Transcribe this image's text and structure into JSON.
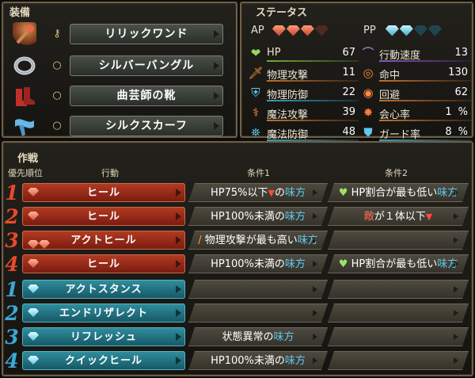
{
  "equipment": {
    "title": "装備",
    "items": [
      {
        "name": "リリックワンド",
        "type_icon": "key-icon",
        "icon": "wand-icon"
      },
      {
        "name": "シルバーバングル",
        "type_icon": "ring-icon",
        "icon": "bangle-icon"
      },
      {
        "name": "曲芸師の靴",
        "type_icon": "ring-icon",
        "icon": "boots-icon"
      },
      {
        "name": "シルクスカーフ",
        "type_icon": "ring-icon",
        "icon": "scarf-icon"
      }
    ]
  },
  "status": {
    "title": "ステータス",
    "ap_label": "AP",
    "pp_label": "PP",
    "ap_filled": 3,
    "ap_total": 4,
    "pp_filled": 2,
    "pp_total": 4,
    "left": [
      {
        "label": "HP",
        "value": "67",
        "icon": "heart-icon"
      },
      {
        "label": "物理攻撃",
        "value": "11",
        "icon": "sword-icon"
      },
      {
        "label": "物理防御",
        "value": "22",
        "icon": "armor-icon"
      },
      {
        "label": "魔法攻撃",
        "value": "39",
        "icon": "staff-icon"
      },
      {
        "label": "魔法防御",
        "value": "48",
        "icon": "magic-shield-icon"
      }
    ],
    "right": [
      {
        "label": "行動速度",
        "value": "13",
        "icon": "speed-icon"
      },
      {
        "label": "命中",
        "value": "130",
        "icon": "target-icon"
      },
      {
        "label": "回避",
        "value": "62",
        "icon": "evade-icon"
      },
      {
        "label": "会心率",
        "value": "1",
        "unit": "%",
        "icon": "critical-icon"
      },
      {
        "label": "ガード率",
        "value": "8",
        "unit": "%",
        "icon": "guard-icon"
      }
    ]
  },
  "tactics": {
    "title": "作戦",
    "col_priority": "優先順位",
    "col_action": "行動",
    "col_cond1": "条件1",
    "col_cond2": "条件2",
    "rows": [
      {
        "priority": "1",
        "color": "red",
        "gems": 1,
        "action": "ヒール",
        "c1": [
          "HP75%以下",
          "▼",
          "の",
          "味方"
        ],
        "c2": [
          "HP割合が最も低い",
          "味方"
        ]
      },
      {
        "priority": "2",
        "color": "red",
        "gems": 1,
        "action": "ヒール",
        "c1": [
          "HP100%未満の",
          "味方"
        ],
        "c2": [
          "敵",
          "が１体以下",
          "▼"
        ]
      },
      {
        "priority": "3",
        "color": "red",
        "gems": 2,
        "action": "アクトヒール",
        "c1": [
          "物理攻撃が最も高い",
          "味方"
        ],
        "c2": []
      },
      {
        "priority": "4",
        "color": "red",
        "gems": 1,
        "action": "ヒール",
        "c1": [
          "HP100%未満の",
          "味方"
        ],
        "c2": [
          "HP割合が最も低い",
          "味方"
        ]
      },
      {
        "priority": "1",
        "color": "blue",
        "gems": 1,
        "action": "アクトスタンス",
        "c1": [],
        "c2": []
      },
      {
        "priority": "2",
        "color": "blue",
        "gems": 1,
        "action": "エンドリザレクト",
        "c1": [],
        "c2": []
      },
      {
        "priority": "3",
        "color": "blue",
        "gems": 1,
        "action": "リフレッシュ",
        "c1": [
          "状態異常の",
          "味方"
        ],
        "c2": []
      },
      {
        "priority": "4",
        "color": "blue",
        "gems": 1,
        "action": "クイックヒール",
        "c1": [
          "HP100%未満の",
          "味方"
        ],
        "c2": []
      }
    ]
  }
}
